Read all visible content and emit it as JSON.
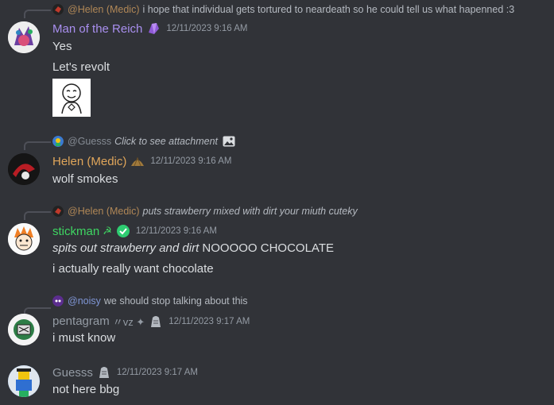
{
  "colors": {
    "background": "#313338",
    "text": "#dbdee1",
    "muted": "#949ba4",
    "mention": "#c9cdfb"
  },
  "messages": [
    {
      "reply": {
        "name": "@Helen (Medic)",
        "name_color": "#c7965c",
        "text": "i hope that individual gets tortured to neardeath so he could tell us what hapenned :3"
      },
      "author": "Man of the Reich",
      "author_color": "#a98fef",
      "badge_icon": "amethyst-badge-icon",
      "timestamp": "12/11/2023 9:16 AM",
      "lines": [
        "Yes",
        "Let's revolt"
      ],
      "attachment": "emote-image"
    },
    {
      "reply": {
        "name": "@Guesss",
        "name_color": "#949ba4",
        "text": "Click to see attachment",
        "icon": "image-icon"
      },
      "author": "Helen (Medic)",
      "author_color": "#e0a65a",
      "badge_icon": "shell-badge-icon",
      "timestamp": "12/11/2023 9:16 AM",
      "lines": [
        "wolf smokes"
      ]
    },
    {
      "reply": {
        "name": "@Helen (Medic)",
        "name_color": "#c7965c",
        "text": "puts strawberry mixed with dirt your miuth cuteky"
      },
      "author": "stickman",
      "author_suffix": "☭",
      "author_color": "#3ed662",
      "badge_icon": "green-badge-icon",
      "timestamp": "12/11/2023 9:16 AM",
      "lines": [
        "i actually really want chocolate"
      ],
      "line1_italic": "spits out strawberry and dirt",
      "line1_rest": " NOOOOO CHOCOLATE"
    },
    {
      "reply": {
        "name": "@noisy",
        "name_color": "#8da7f0",
        "text": "we should stop talking about this"
      },
      "author": "pentagram",
      "author_suffix": "〃vz ✦",
      "author_color": "#949ba4",
      "badge_icon": "grey-badge-icon",
      "timestamp": "12/11/2023 9:17 AM",
      "lines": [
        "i must know"
      ]
    },
    {
      "author": "Guesss",
      "author_color": "#949ba4",
      "badge_icon": "grey-badge-icon",
      "timestamp": "12/11/2023 9:17 AM",
      "lines": [
        "not here bbg"
      ]
    }
  ]
}
